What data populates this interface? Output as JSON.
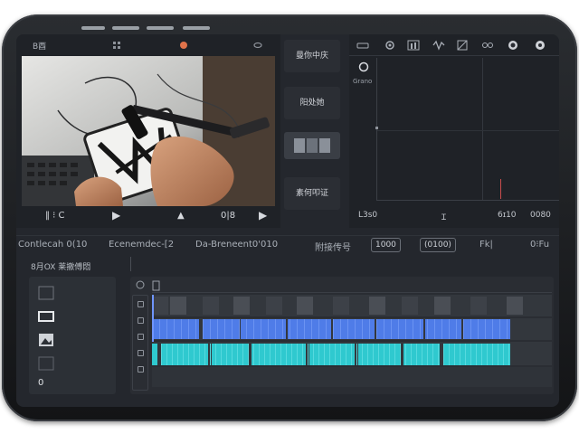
{
  "preview": {
    "title": "B酉",
    "transport": {
      "timecode_left": "‖ ⁝ C",
      "play_label": "▶",
      "marker_label": "▲",
      "timecode_right": "0|8",
      "play2_label": "▶"
    }
  },
  "effects": {
    "items": [
      {
        "label": "曼你中庆"
      },
      {
        "label": "阳处她"
      },
      {
        "label": ""
      },
      {
        "label": "素何叩证"
      }
    ]
  },
  "scope": {
    "label": "Grano",
    "footer": {
      "left": "L3s0",
      "center": "Ɪ",
      "right1": "6ɪ10",
      "right2": "0080"
    }
  },
  "toolbar": {
    "items": [
      {
        "label": "Contlecah 0(10"
      },
      {
        "label": "Ecenemdec-[2"
      },
      {
        "label": "Da-Breneent0'010"
      },
      {
        "label": "附接传号"
      },
      {
        "label": "1000"
      },
      {
        "label": "(0100)"
      },
      {
        "label": "Fk|"
      },
      {
        "label": "0⁝Fu"
      }
    ]
  },
  "timeline": {
    "label": "8月OX 莱撤傅悶",
    "bin_count": "0"
  },
  "colors": {
    "accent_blue": "#4f7ce8",
    "accent_teal": "#2fc9cf",
    "panel_bg": "#1f2227",
    "scope_marker": "#c94d4d"
  }
}
